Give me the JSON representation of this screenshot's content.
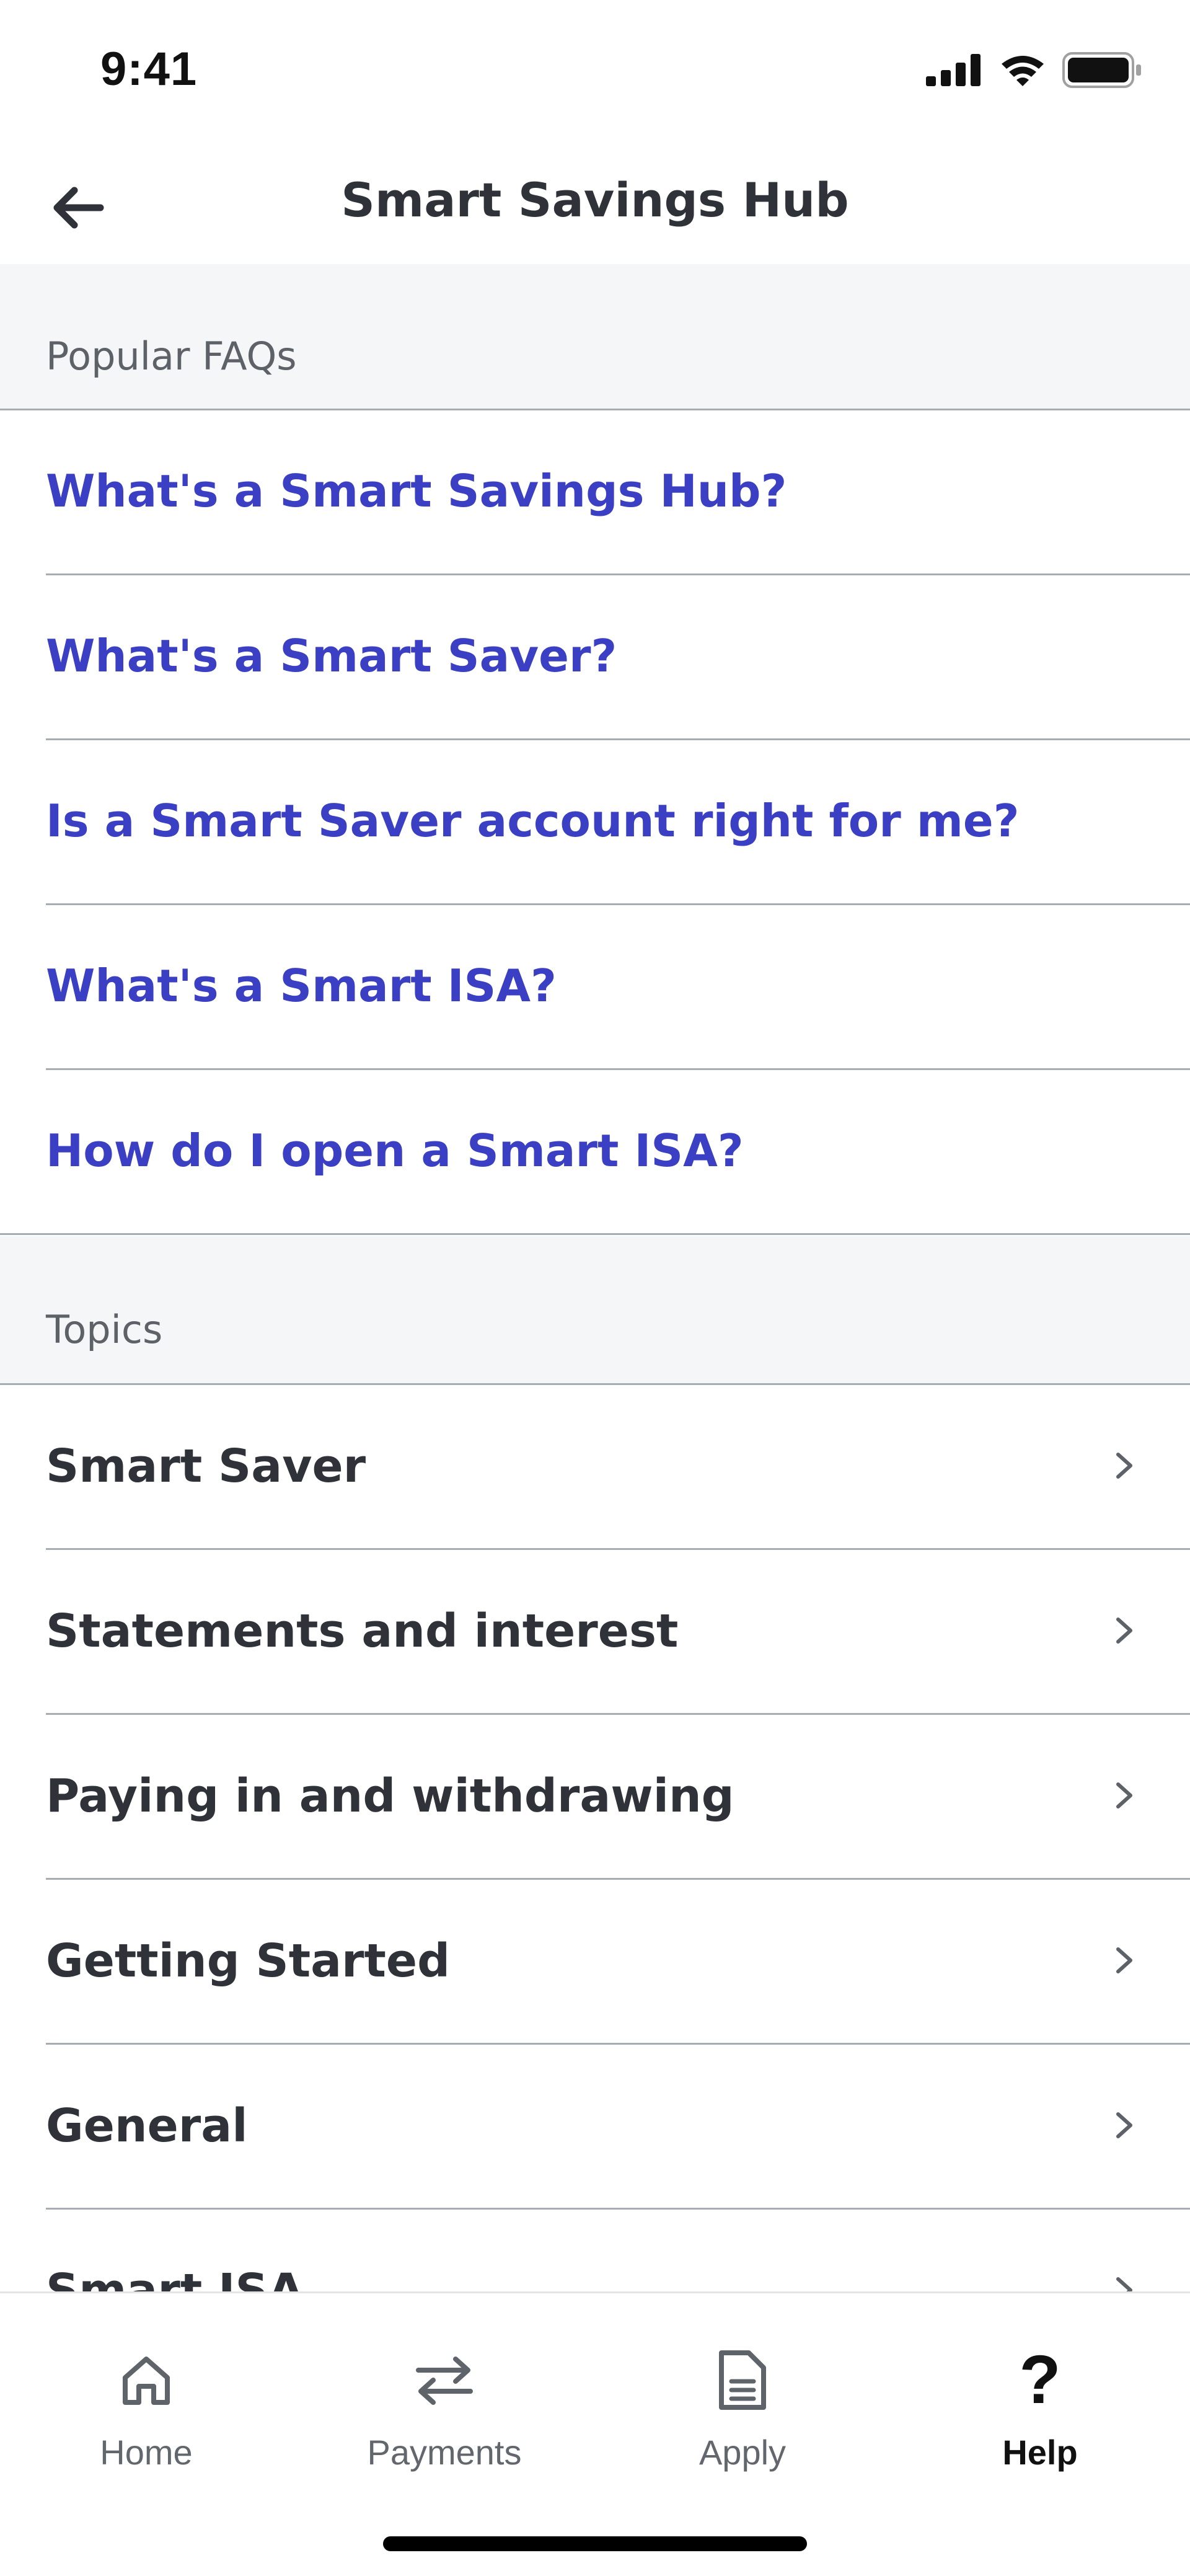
{
  "status_bar": {
    "time": "9:41",
    "icons": [
      "cellular-signal-icon",
      "wifi-icon",
      "battery-icon"
    ]
  },
  "header": {
    "title": "Smart Savings Hub",
    "back_icon": "arrow-left-icon"
  },
  "faqs": {
    "section_label": "Popular FAQs",
    "items": [
      "What's a Smart Savings Hub?",
      "What's a Smart Saver?",
      "Is a Smart Saver account right for me?",
      "What's a Smart ISA?",
      "How do I open a Smart ISA?"
    ]
  },
  "topics": {
    "section_label": "Topics",
    "items": [
      "Smart Saver",
      "Statements and interest",
      "Paying in and withdrawing",
      "Getting Started",
      "General",
      "Smart ISA"
    ],
    "chevron_icon": "chevron-right-icon"
  },
  "tab_bar": {
    "tabs": [
      {
        "label": "Home",
        "icon": "home-icon",
        "active": false
      },
      {
        "label": "Payments",
        "icon": "transfer-arrows-icon",
        "active": false
      },
      {
        "label": "Apply",
        "icon": "document-icon",
        "active": false
      },
      {
        "label": "Help",
        "icon": "question-mark-icon",
        "active": true
      }
    ]
  },
  "colors": {
    "link": "#3a3fc3",
    "text": "#2f3238",
    "muted": "#5d6168",
    "section_bg": "#f5f6f7",
    "divider": "#a7adb5"
  }
}
